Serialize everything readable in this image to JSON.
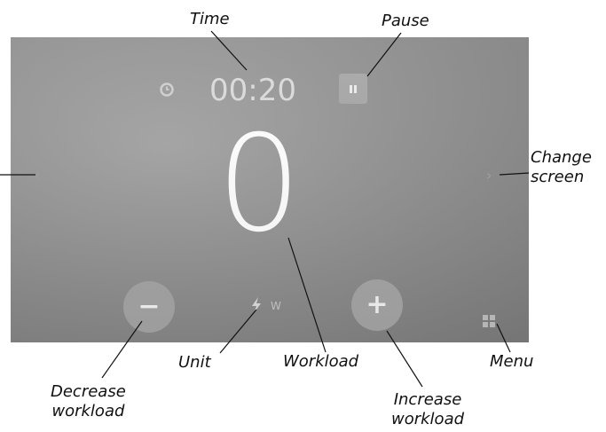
{
  "screen": {
    "time": "00:20",
    "workload_value": "0",
    "unit": "W",
    "minus_label": "−",
    "plus_label": "+",
    "left_arrow": "‹",
    "right_arrow": "›",
    "icons": {
      "clock": "clock-icon",
      "pause": "pause-icon",
      "bolt": "bolt-icon",
      "menu": "menu-icon"
    }
  },
  "callouts": {
    "time": "Time",
    "pause": "Pause",
    "change_screen_1": "Change",
    "change_screen_2": "screen",
    "unit": "Unit",
    "workload": "Workload",
    "menu": "Menu",
    "decrease_1": "Decrease",
    "decrease_2": "workload",
    "increase_1": "Increase",
    "increase_2": "workload"
  },
  "colors": {
    "screen_bg": "#939393",
    "text_light": "#ffffff",
    "button_bg": "#a6a6a6"
  }
}
